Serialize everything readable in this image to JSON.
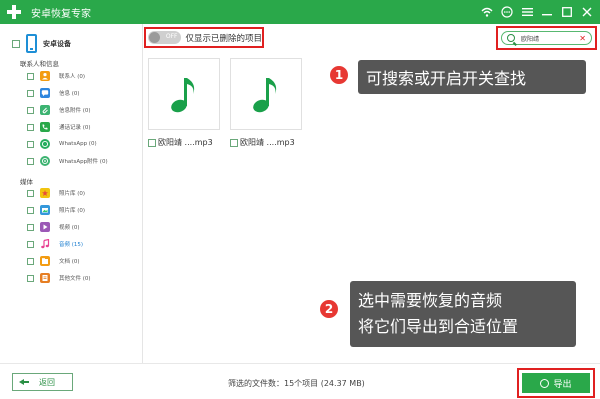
{
  "window": {
    "title": "安卓恢复专家"
  },
  "sidebar": {
    "device_label": "安卓设备",
    "groups": [
      {
        "title": "联系人和信息",
        "items": [
          {
            "label": "联系人 (0)",
            "icon": "contacts-icon",
            "color": "#f39c12"
          },
          {
            "label": "信息 (0)",
            "icon": "messages-icon",
            "color": "#2e86de"
          },
          {
            "label": "信息附件 (0)",
            "icon": "message-attachment-icon",
            "color": "#3cb371"
          },
          {
            "label": "通话记录 (0)",
            "icon": "call-log-icon",
            "color": "#2aa84a"
          },
          {
            "label": "WhatsApp (0)",
            "icon": "whatsapp-icon",
            "color": "#27ae60"
          },
          {
            "label": "WhatsApp附件 (0)",
            "icon": "whatsapp-attachment-icon",
            "color": "#3cb371"
          }
        ]
      },
      {
        "title": "媒体",
        "items": [
          {
            "label": "照片库 (0)",
            "icon": "photo-library-icon",
            "color": "#f1c40f"
          },
          {
            "label": "照片库 (0)",
            "icon": "photo-stream-icon",
            "color": "#3498db"
          },
          {
            "label": "视频 (0)",
            "icon": "video-icon",
            "color": "#9b59b6"
          },
          {
            "label": "音频 (15)",
            "icon": "audio-icon",
            "color": "#e84393",
            "active": true
          },
          {
            "label": "文档 (0)",
            "icon": "documents-icon",
            "color": "#f39c12"
          },
          {
            "label": "其他文件 (0)",
            "icon": "other-files-icon",
            "color": "#e67e22"
          }
        ]
      }
    ]
  },
  "toolbar": {
    "toggle_state": "OFF",
    "toggle_label": "仅显示已删除的项目",
    "search_value": "欧阳靖"
  },
  "files": [
    {
      "name": "欧阳靖 ....mp3",
      "icon": "music-note-icon"
    },
    {
      "name": "欧阳靖 ....mp3",
      "icon": "music-note-icon"
    }
  ],
  "callouts": [
    {
      "number": "1",
      "lines": [
        "可搜索或开启开关查找"
      ]
    },
    {
      "number": "2",
      "lines": [
        "选中需要恢复的音频",
        "将它们导出到合适位置"
      ]
    }
  ],
  "footer": {
    "back_label": "返回",
    "status": "筛选的文件数：15个项目  (24.37 MB)",
    "export_label": "导出"
  },
  "colors": {
    "brand": "#2aa84a",
    "highlight": "#e02020",
    "callout_bg": "#565656"
  }
}
